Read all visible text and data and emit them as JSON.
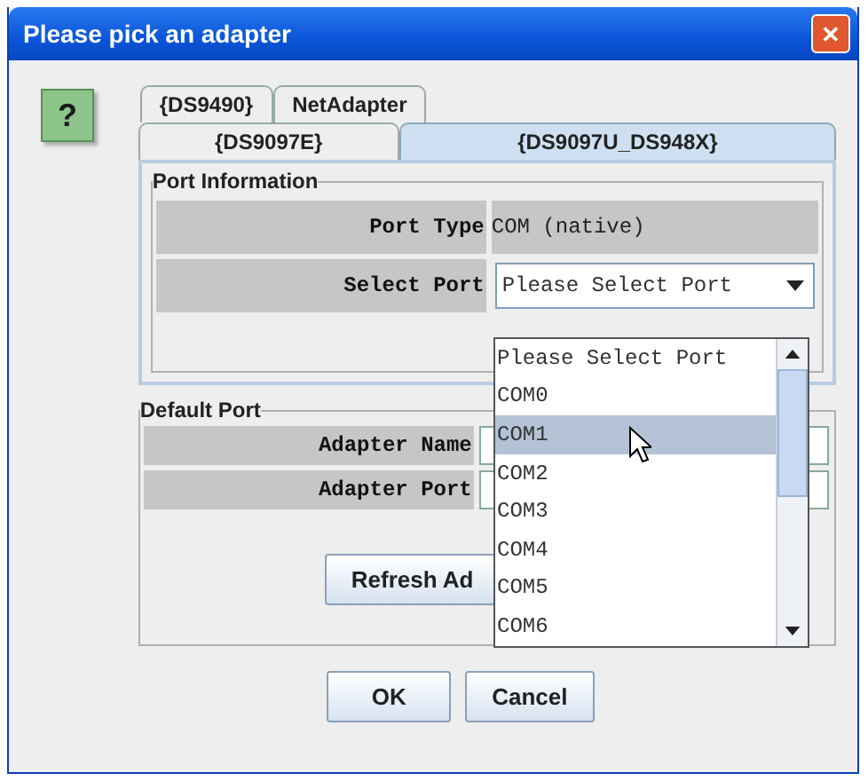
{
  "window": {
    "title": "Please pick an adapter",
    "close": "✕"
  },
  "help_icon": "?",
  "tab_rows": [
    [
      {
        "label": "{DS9490}",
        "selected": false
      },
      {
        "label": "NetAdapter",
        "selected": false
      }
    ],
    [
      {
        "label": "{DS9097E}",
        "selected": false
      },
      {
        "label": "{DS9097U_DS948X}",
        "selected": true
      }
    ]
  ],
  "port_information": {
    "title": "Port Information",
    "rows": [
      {
        "label": "Port Type",
        "kind": "text",
        "value": "COM (native)"
      },
      {
        "label": "Select Port",
        "kind": "combo",
        "value": "Please Select Port"
      }
    ]
  },
  "port_dropdown": {
    "items": [
      {
        "label": "Please Select Port",
        "selected": false
      },
      {
        "label": "COM0",
        "selected": false
      },
      {
        "label": "COM1",
        "selected": true
      },
      {
        "label": "COM2",
        "selected": false
      },
      {
        "label": "COM3",
        "selected": false
      },
      {
        "label": "COM4",
        "selected": false
      },
      {
        "label": "COM5",
        "selected": false
      },
      {
        "label": "COM6",
        "selected": false
      }
    ]
  },
  "default_port": {
    "title": "Default Port",
    "rows": [
      {
        "label": "Adapter Name"
      },
      {
        "label": "Adapter Port"
      }
    ],
    "button": "Refresh Ad"
  },
  "buttons": [
    "OK",
    "Cancel"
  ]
}
